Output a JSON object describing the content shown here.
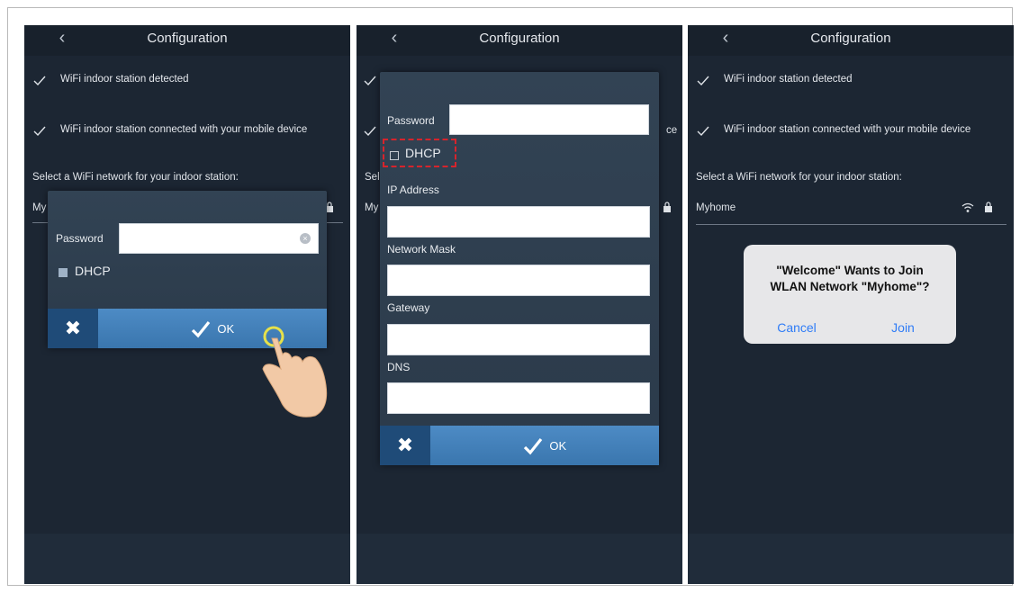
{
  "screen_title": "Configuration",
  "steps": {
    "detected": "WiFi indoor station detected",
    "connected": "WiFi indoor station connected with your mobile device",
    "connected_truncated": "ce"
  },
  "select_prompt": "Select a WiFi network for your indoor station:",
  "network": {
    "name": "Myhome",
    "name_truncated": "My",
    "prompt_truncated": "Sel"
  },
  "dialog1": {
    "password_label": "Password",
    "password_value": "",
    "dhcp_label": "DHCP",
    "dhcp_checked": true,
    "cancel_icon": "close-icon",
    "ok_label": "OK"
  },
  "dialog2": {
    "password_label": "Password",
    "password_value": "",
    "dhcp_label": "DHCP",
    "dhcp_checked": false,
    "ip_label": "IP Address",
    "mask_label": "Network Mask",
    "gateway_label": "Gateway",
    "dns_label": "DNS",
    "ok_label": "OK"
  },
  "alert": {
    "title_line1": "\"Welcome\" Wants to Join",
    "title_line2": "WLAN Network \"Myhome\"?",
    "cancel_label": "Cancel",
    "join_label": "Join"
  },
  "colors": {
    "background": "#1c2633",
    "accent": "#3a76ae",
    "highlight": "#d6242c",
    "alert_link": "#2f7cf6"
  }
}
